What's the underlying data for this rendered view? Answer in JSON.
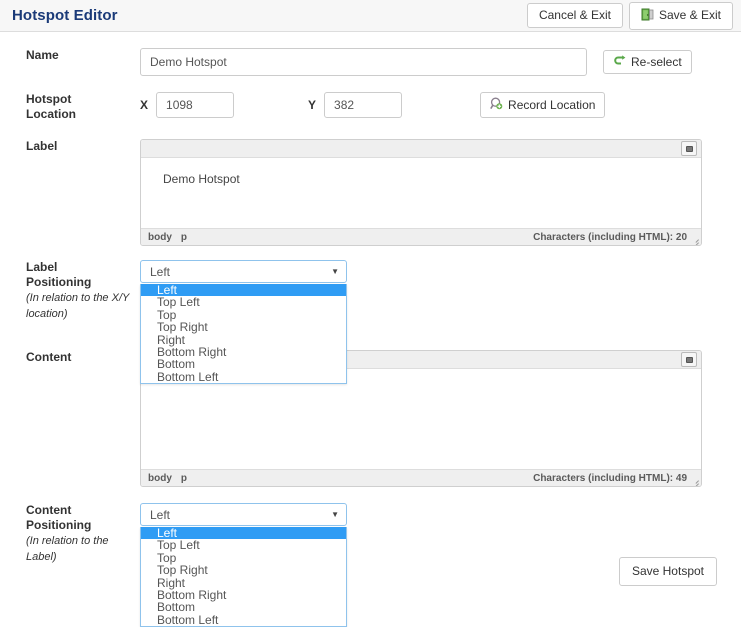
{
  "header": {
    "title": "Hotspot Editor",
    "cancel_label": "Cancel & Exit",
    "save_label": "Save & Exit"
  },
  "form": {
    "name": {
      "label": "Name",
      "value": "Demo Hotspot",
      "reselect_label": "Re-select"
    },
    "location": {
      "label_line1": "Hotspot",
      "label_line2": "Location",
      "x_label": "X",
      "x_value": "1098",
      "y_label": "Y",
      "y_value": "382",
      "record_label": "Record Location"
    },
    "label_editor": {
      "label": "Label",
      "content": "Demo Hotspot",
      "path": [
        "body",
        "p"
      ],
      "char_count": "Characters (including HTML): 20"
    },
    "label_positioning": {
      "label_line1": "Label",
      "label_line2": "Positioning",
      "sub_line1": "(In relation to the X/Y",
      "sub_line2": "location)",
      "selected": "Left",
      "options": [
        "Left",
        "Top Left",
        "Top",
        "Top Right",
        "Right",
        "Bottom Right",
        "Bottom",
        "Bottom Left"
      ]
    },
    "content_editor": {
      "label": "Content",
      "content": "",
      "path": [
        "body",
        "p"
      ],
      "char_count": "Characters (including HTML): 49"
    },
    "content_positioning": {
      "label_line1": "Content",
      "label_line2": "Positioning",
      "sub_line1": "(In relation to the",
      "sub_line2": "Label)",
      "selected": "Left",
      "options": [
        "Left",
        "Top Left",
        "Top",
        "Top Right",
        "Right",
        "Bottom Right",
        "Bottom",
        "Bottom Left"
      ]
    },
    "save_hotspot_label": "Save Hotspot"
  },
  "icons": {
    "save_exit": "exit-door-icon",
    "reselect": "undo-arrow-icon",
    "record_location": "magnifier-plus-icon",
    "editor_toggle": "toolbar-toggle-icon",
    "select_caret": "chevron-down-icon"
  },
  "colors": {
    "title": "#1a3a78",
    "header_bg": "#f7f7f7",
    "select_highlight": "#2f9cf4",
    "select_border": "#8fc3ec",
    "icon_green": "#5aa84a"
  }
}
